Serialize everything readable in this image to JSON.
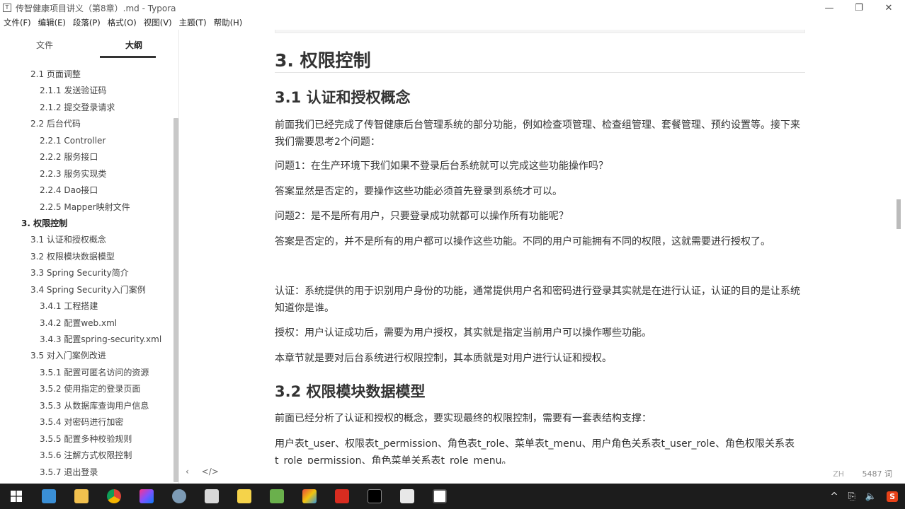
{
  "window": {
    "title": "传智健康项目讲义（第8章）.md - Typora",
    "app_icon": "T",
    "minimize": "—",
    "maximize": "❐",
    "close": "✕"
  },
  "menu": [
    "文件(F)",
    "编辑(E)",
    "段落(P)",
    "格式(O)",
    "视图(V)",
    "主题(T)",
    "帮助(H)"
  ],
  "sidebar": {
    "tabs": [
      "文件",
      "大纲"
    ],
    "active_tab": "大纲",
    "outline": [
      {
        "level": 2,
        "text": "2.1 页面调整"
      },
      {
        "level": 3,
        "text": "2.1.1 发送验证码"
      },
      {
        "level": 3,
        "text": "2.1.2 提交登录请求"
      },
      {
        "level": 2,
        "text": "2.2 后台代码"
      },
      {
        "level": 3,
        "text": "2.2.1 Controller"
      },
      {
        "level": 3,
        "text": "2.2.2 服务接口"
      },
      {
        "level": 3,
        "text": "2.2.3 服务实现类"
      },
      {
        "level": 3,
        "text": "2.2.4 Dao接口"
      },
      {
        "level": 3,
        "text": "2.2.5 Mapper映射文件"
      },
      {
        "level": 1,
        "text": "3. 权限控制"
      },
      {
        "level": 2,
        "text": "3.1 认证和授权概念"
      },
      {
        "level": 2,
        "text": "3.2 权限模块数据模型"
      },
      {
        "level": 2,
        "text": "3.3 Spring Security简介"
      },
      {
        "level": 2,
        "text": "3.4 Spring Security入门案例"
      },
      {
        "level": 3,
        "text": "3.4.1 工程搭建"
      },
      {
        "level": 3,
        "text": "3.4.2 配置web.xml"
      },
      {
        "level": 3,
        "text": "3.4.3 配置spring-security.xml"
      },
      {
        "level": 2,
        "text": "3.5 对入门案例改进"
      },
      {
        "level": 3,
        "text": "3.5.1 配置可匿名访问的资源"
      },
      {
        "level": 3,
        "text": "3.5.2 使用指定的登录页面"
      },
      {
        "level": 3,
        "text": "3.5.3 从数据库查询用户信息"
      },
      {
        "level": 3,
        "text": "3.5.4 对密码进行加密"
      },
      {
        "level": 3,
        "text": "3.5.5 配置多种校验规则"
      },
      {
        "level": 3,
        "text": "3.5.6 注解方式权限控制"
      },
      {
        "level": 3,
        "text": "3.5.7 退出登录"
      }
    ]
  },
  "document": {
    "h1": "3. 权限控制",
    "h2_1": "3.1 认证和授权概念",
    "p1": "前面我们已经完成了传智健康后台管理系统的部分功能，例如检查项管理、检查组管理、套餐管理、预约设置等。接下来我们需要思考2个问题：",
    "p2": "问题1：在生产环境下我们如果不登录后台系统就可以完成这些功能操作吗？",
    "p3": "答案显然是否定的，要操作这些功能必须首先登录到系统才可以。",
    "p4": "问题2：是不是所有用户，只要登录成功就都可以操作所有功能呢？",
    "p5": "答案是否定的，并不是所有的用户都可以操作这些功能。不同的用户可能拥有不同的权限，这就需要进行授权了。",
    "p6": "认证：系统提供的用于识别用户身份的功能，通常提供用户名和密码进行登录其实就是在进行认证，认证的目的是让系统知道你是谁。",
    "p7": "授权：用户认证成功后，需要为用户授权，其实就是指定当前用户可以操作哪些功能。",
    "p8": "本章节就是要对后台系统进行权限控制，其本质就是对用户进行认证和授权。",
    "h2_2": "3.2 权限模块数据模型",
    "p9": "前面已经分析了认证和授权的概念，要实现最终的权限控制，需要有一套表结构支撑：",
    "p10": "用户表t_user、权限表t_permission、角色表t_role、菜单表t_menu、用户角色关系表t_user_role、角色权限关系表t_role_permission、角色菜单关系表t_role_menu。"
  },
  "status": {
    "back": "‹",
    "source_toggle": "</>",
    "lang": "ZH",
    "word_count": "5487 词"
  },
  "taskbar": {
    "icons": [
      "windows-start",
      "explorer",
      "folder",
      "chrome",
      "intellij",
      "app-bird",
      "photo-app",
      "notes-app",
      "green-app",
      "colorful-app",
      "redis-app",
      "terminal",
      "window-app",
      "typora"
    ],
    "tray": [
      "^",
      "⎘",
      "🔈",
      "S"
    ]
  }
}
